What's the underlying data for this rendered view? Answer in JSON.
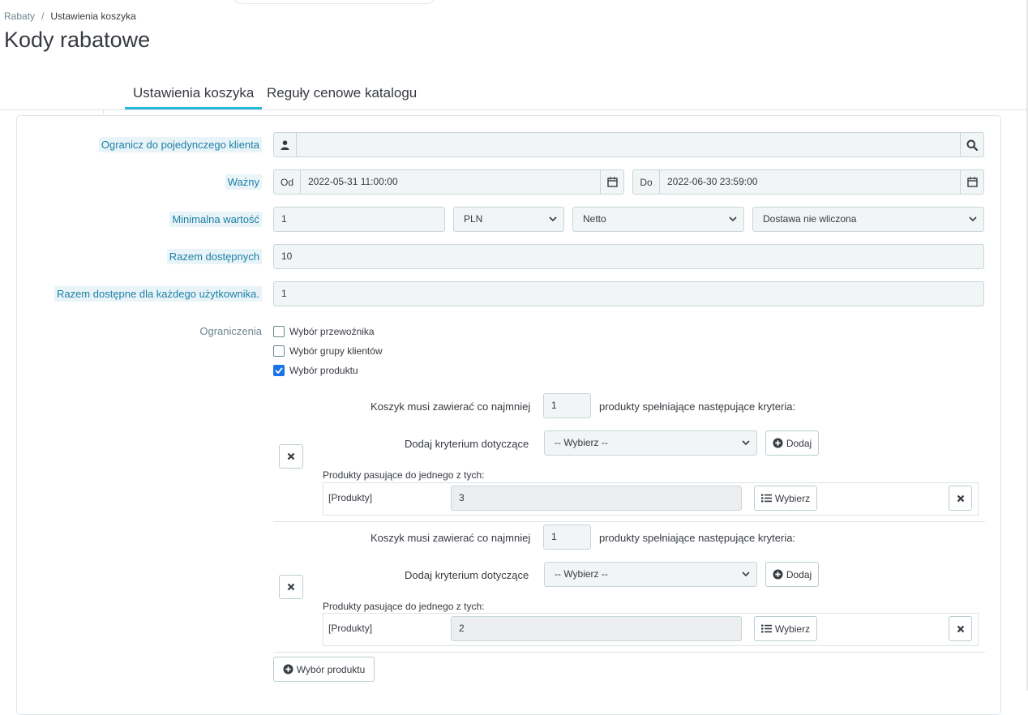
{
  "breadcrumb": {
    "parent": "Rabaty",
    "separator": "/",
    "current": "Ustawienia koszyka"
  },
  "page_title": "Kody rabatowe",
  "tabs": [
    {
      "label": "Ustawienia koszyka",
      "active": true
    },
    {
      "label": "Reguły cenowe katalogu",
      "active": false
    }
  ],
  "form": {
    "customer": {
      "label": "Ogranicz do pojedynczego klienta",
      "value": "",
      "icons": [
        "user-icon",
        "search-icon"
      ]
    },
    "valid": {
      "label": "Ważny",
      "from_label": "Od",
      "from_value": "2022-05-31 11:00:00",
      "to_label": "Do",
      "to_value": "2022-06-30 23:59:00"
    },
    "min_amount": {
      "label": "Minimalna wartość",
      "value": "1",
      "currency": "PLN",
      "tax": "Netto",
      "shipping": "Dostawa nie wliczona"
    },
    "total_available": {
      "label": "Razem dostępnych",
      "value": "10"
    },
    "per_user": {
      "label": "Razem dostępne dla każdego użytkownika.",
      "value": "1"
    },
    "restrictions": {
      "label": "Ograniczenia",
      "options": [
        {
          "label": "Wybór przewoźnika",
          "checked": false
        },
        {
          "label": "Wybór grupy klientów",
          "checked": false
        },
        {
          "label": "Wybór produktu",
          "checked": true
        }
      ]
    },
    "product_rule_groups": [
      {
        "cart_prefix": "Koszyk musi zawierać co najmniej",
        "quantity": "1",
        "cart_suffix": "produkty spełniające następujące kryteria:",
        "add_rule_label": "Dodaj kryterium dotyczące",
        "select_placeholder": "-- Wybierz --",
        "add_button": "Dodaj",
        "match_label": "Produkty pasujące do jednego z tych:",
        "rule_type": "[Produkty]",
        "rule_count": "3",
        "choose_button": "Wybierz"
      },
      {
        "cart_prefix": "Koszyk musi zawierać co najmniej",
        "quantity": "1",
        "cart_suffix": "produkty spełniające następujące kryteria:",
        "add_rule_label": "Dodaj kryterium dotyczące",
        "select_placeholder": "-- Wybierz --",
        "add_button": "Dodaj",
        "match_label": "Produkty pasujące do jednego z tych:",
        "rule_type": "[Produkty]",
        "rule_count": "2",
        "choose_button": "Wybierz"
      }
    ],
    "add_product_selection_button": "Wybór produktu"
  },
  "colors": {
    "accent": "#25b9d7",
    "label_hint": "#1d7fa6",
    "checkbox_checked": "#1a73e8",
    "input_bg": "#f2f5f6"
  }
}
